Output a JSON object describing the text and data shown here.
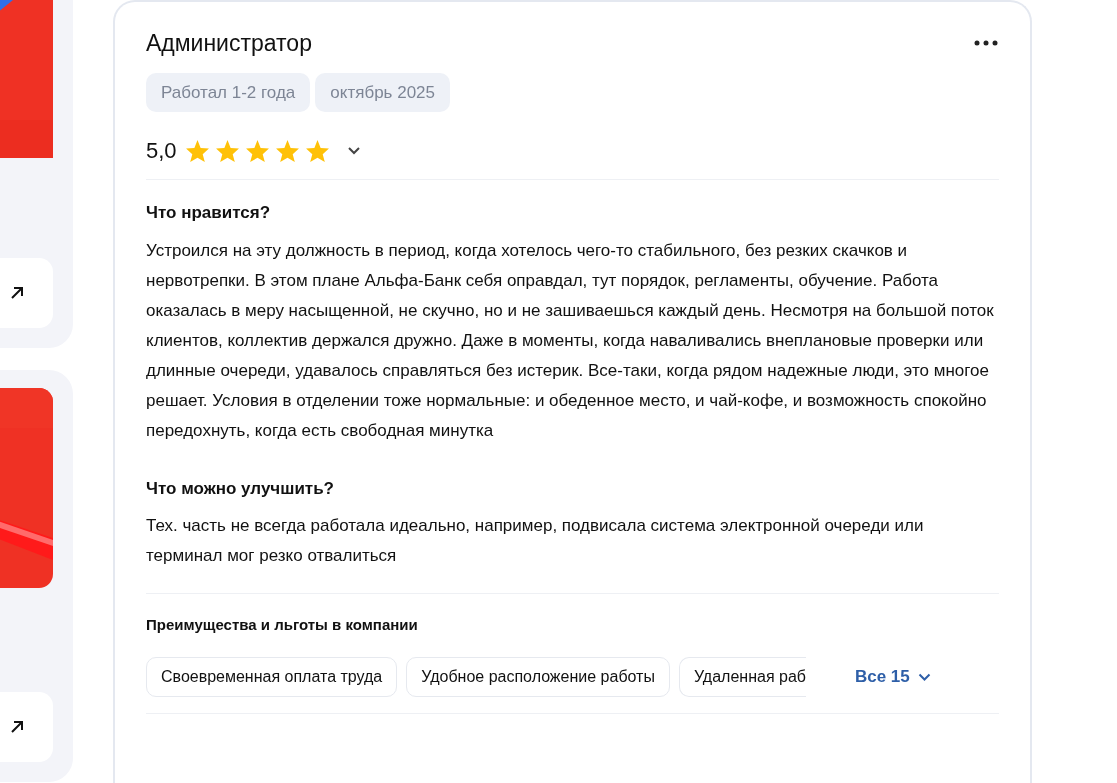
{
  "review": {
    "position": "Администратор",
    "tags": [
      "Работал 1-2 года",
      "октябрь 2025"
    ],
    "rating": "5,0",
    "stars": 5,
    "expanded": false,
    "sections": [
      {
        "heading": "Что нравится?",
        "text": "Устроился на эту должность в период, когда хотелось чего-то стабильного, без резких скачков и нервотрепки. В этом плане Альфа-Банк себя оправдал, тут порядок, регламенты, обучение. Работа оказалась в меру насыщенной, не скучно, но и не зашиваешься каждый день. Несмотря на большой поток клиентов, коллектив держался дружно. Даже в моменты, когда наваливались внеплановые проверки или длинные очереди, удавалось справляться без истерик. Все-таки, когда рядом надежные люди, это многое решает. Условия в отделении тоже нормальные: и обеденное место, и чай-кофе, и возможность спокойно передохнуть, когда есть свободная минутка"
      },
      {
        "heading": "Что можно улучшить?",
        "text": "Тех. часть не всегда работала идеально, например, подвисала система электронной очереди или терминал мог резко отвалиться"
      }
    ],
    "benefits": {
      "heading": "Преимущества и льготы в компании",
      "items": [
        "Своевременная оплата труда",
        "Удобное расположение работы",
        "Удаленная раб"
      ],
      "more": "Все 15"
    }
  }
}
